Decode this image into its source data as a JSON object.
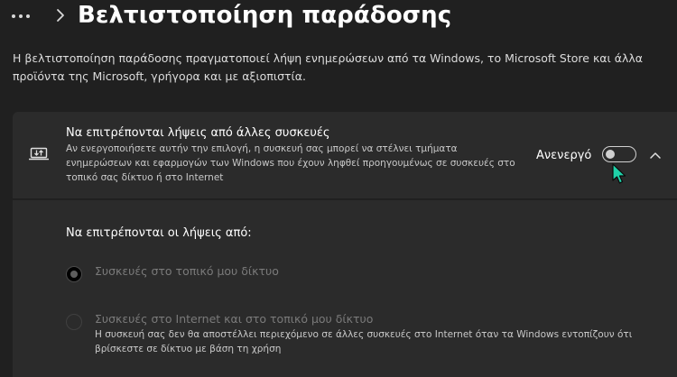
{
  "header": {
    "title": "Βελτιστοποίηση παράδοσης"
  },
  "description": "Η βελτιστοποίηση παράδοσης πραγματοποιεί λήψη ενημερώσεων από τα Windows, το Microsoft Store και άλλα προϊόντα της Microsoft, γρήγορα και με αξιοπιστία.",
  "card": {
    "title": "Να επιτρέπονται λήψεις από άλλες συσκευές",
    "description": "Αν ενεργοποιήσετε αυτήν την επιλογή, η συσκευή σας μπορεί να στέλνει τμήματα ενημερώσεων και εφαρμογών των Windows που έχουν ληφθεί προηγουμένως σε συσκευές στο τοπικό σας δίκτυο ή στο Internet",
    "toggle_state_label": "Ανενεργό",
    "toggle_on": false,
    "expanded": true,
    "icon": "laptop-download-icon"
  },
  "downloads_from": {
    "label": "Να επιτρέπονται οι λήψεις από:",
    "options": [
      {
        "label": "Συσκευές στο τοπικό μου δίκτυο",
        "selected": true,
        "disabled": true
      },
      {
        "label": "Συσκευές στο Internet και στο τοπικό μου δίκτυο",
        "description": "Η συσκευή σας δεν θα αποστέλλει περιεχόμενο σε άλλες συσκευές στο Internet όταν τα Windows εντοπίζουν ότι βρίσκεστε σε δίκτυο με βάση τη χρήση",
        "selected": false,
        "disabled": true
      }
    ]
  },
  "colors": {
    "background": "#202020",
    "card": "#2b2b2b",
    "cursor": "#1fd1a8"
  }
}
